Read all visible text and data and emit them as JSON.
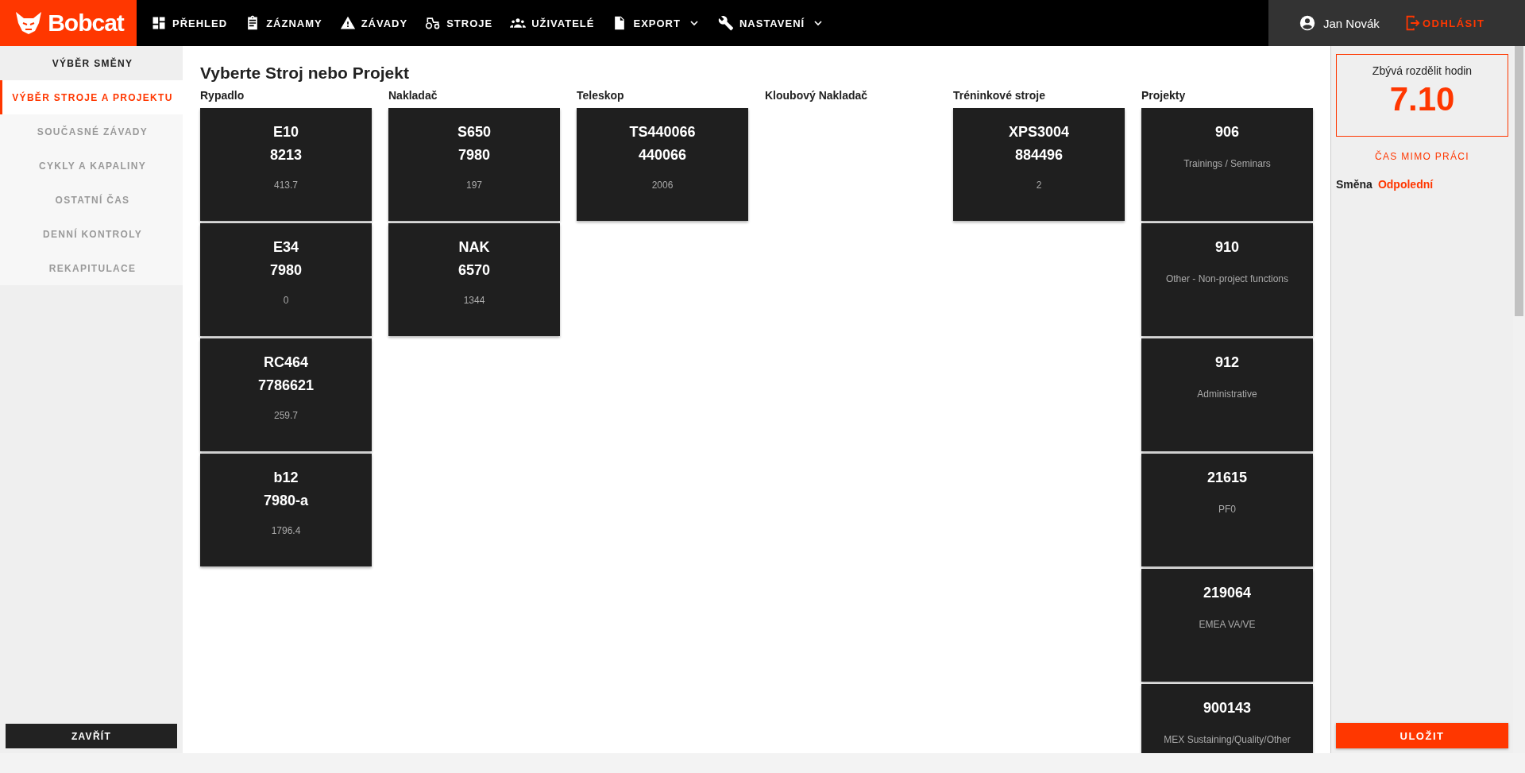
{
  "brand": {
    "name": "Bobcat"
  },
  "nav": [
    {
      "label": "PŘEHLED",
      "dropdown": false
    },
    {
      "label": "ZÁZNAMY",
      "dropdown": false
    },
    {
      "label": "ZÁVADY",
      "dropdown": false
    },
    {
      "label": "STROJE",
      "dropdown": false
    },
    {
      "label": "UŽIVATELÉ",
      "dropdown": false
    },
    {
      "label": "EXPORT",
      "dropdown": true
    },
    {
      "label": "NASTAVENÍ",
      "dropdown": true
    }
  ],
  "user": {
    "name": "Jan Novák",
    "logout": "ODHLÁSIT"
  },
  "sidebar": {
    "items": [
      {
        "label": "VÝBĚR SMĚNY",
        "selected": false,
        "kind": "done"
      },
      {
        "label": "VÝBĚR STROJE A PROJEKTU",
        "selected": true,
        "kind": "step"
      },
      {
        "label": "SOUČASNÉ ZÁVADY",
        "selected": false,
        "kind": "step"
      },
      {
        "label": "CYKLY A KAPALINY",
        "selected": false,
        "kind": "step"
      },
      {
        "label": "OSTATNÍ ČAS",
        "selected": false,
        "kind": "step"
      },
      {
        "label": "DENNÍ KONTROLY",
        "selected": false,
        "kind": "step"
      },
      {
        "label": "REKAPITULACE",
        "selected": false,
        "kind": "step"
      }
    ],
    "close_button": "ZAVŘÍT"
  },
  "main": {
    "title": "Vyberte Stroj nebo Projekt",
    "columns": [
      {
        "heading": "Rypadlo",
        "cards": [
          {
            "kind": "machine",
            "model": "E10",
            "serial": "8213",
            "hours": "413.7"
          },
          {
            "kind": "machine",
            "model": "E34",
            "serial": "7980",
            "hours": "0"
          },
          {
            "kind": "machine",
            "model": "RC464",
            "serial": "7786621",
            "hours": "259.7"
          },
          {
            "kind": "machine",
            "model": "b12",
            "serial": "7980-a",
            "hours": "1796.4"
          }
        ]
      },
      {
        "heading": "Nakladač",
        "cards": [
          {
            "kind": "machine",
            "model": "S650",
            "serial": "7980",
            "hours": "197"
          },
          {
            "kind": "machine",
            "model": "NAK",
            "serial": "6570",
            "hours": "1344"
          }
        ]
      },
      {
        "heading": "Teleskop",
        "cards": [
          {
            "kind": "machine",
            "model": "TS440066",
            "serial": "440066",
            "hours": "2006"
          }
        ]
      },
      {
        "heading": "Kloubový Nakladač"
      },
      {
        "heading": "Tréninkové stroje",
        "cards": [
          {
            "kind": "machine",
            "model": "XPS3004",
            "serial": "884496",
            "hours": "2"
          }
        ]
      },
      {
        "heading": "Projekty",
        "cards": [
          {
            "kind": "project",
            "code": "906",
            "description": "Trainings / Seminars"
          },
          {
            "kind": "project",
            "code": "910",
            "description": "Other - Non-project functions"
          },
          {
            "kind": "project",
            "code": "912",
            "description": "Administrative"
          },
          {
            "kind": "project",
            "code": "21615",
            "description": "PF0"
          },
          {
            "kind": "project",
            "code": "219064",
            "description": "EMEA VA/VE"
          },
          {
            "kind": "project",
            "code": "900143",
            "description": "MEX Sustaining/Quality/Other"
          }
        ]
      }
    ]
  },
  "summary": {
    "remaining_label": "Zbývá rozdělit hodin",
    "remaining_value": "7.10",
    "off_work_link": "ČAS MIMO PRÁCI",
    "shift_label": "Směna",
    "shift_value": "Odpolední",
    "save_button": "ULOŽIT"
  }
}
